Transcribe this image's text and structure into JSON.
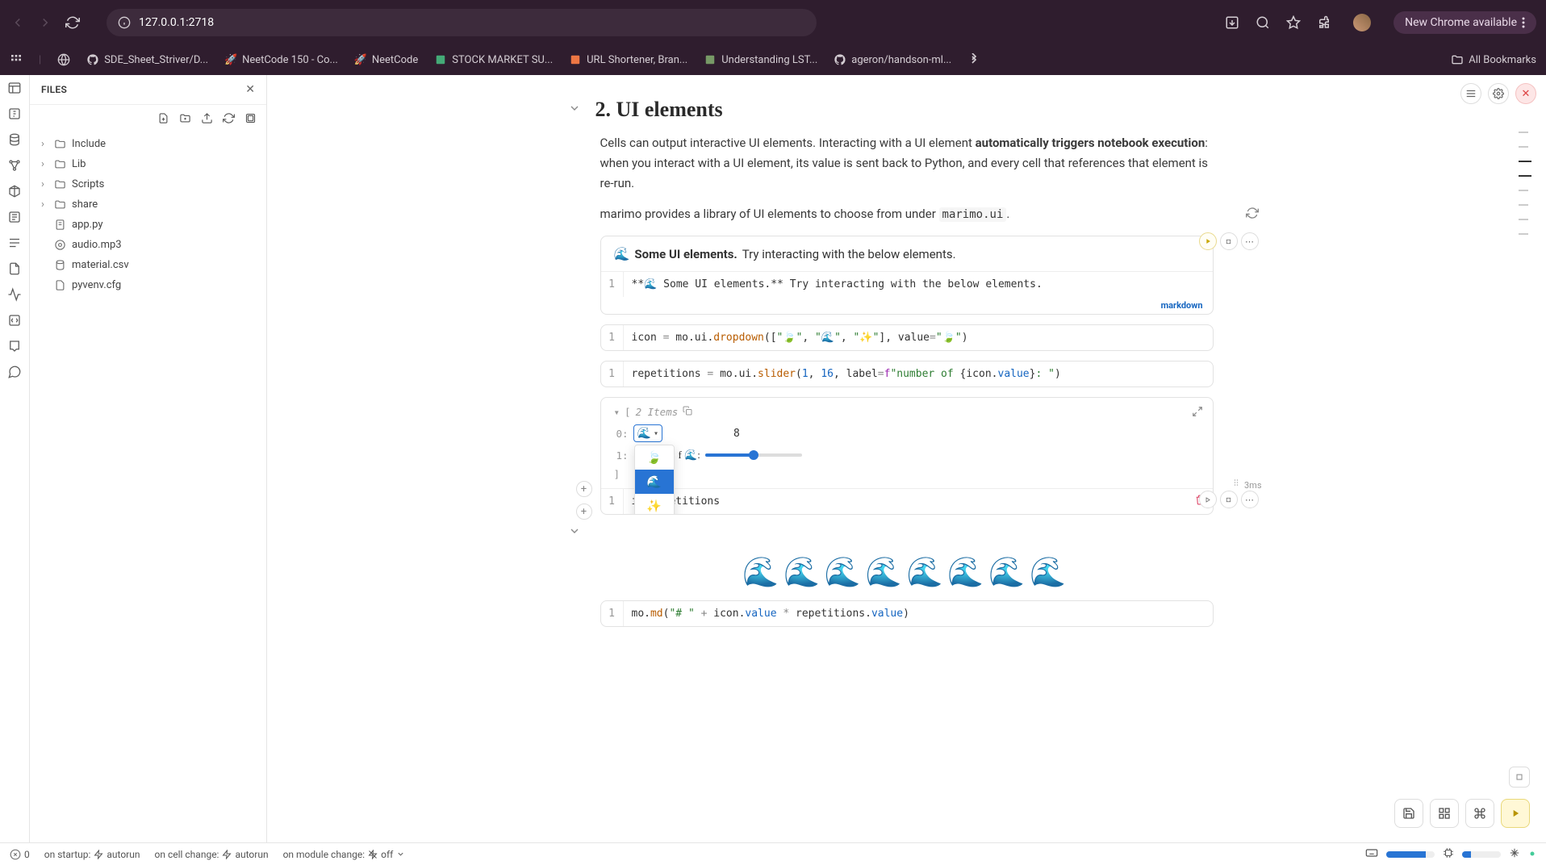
{
  "browser": {
    "url": "127.0.0.1:2718",
    "new_chrome": "New Chrome available",
    "bookmarks": [
      {
        "label": "SDE_Sheet_Striver/D...",
        "icon": "github"
      },
      {
        "label": "NeetCode 150 - Co...",
        "icon": "rocket"
      },
      {
        "label": "NeetCode",
        "icon": "rocket"
      },
      {
        "label": "STOCK MARKET SU...",
        "icon": "doc"
      },
      {
        "label": "URL Shortener, Bran...",
        "icon": "link"
      },
      {
        "label": "Understanding LST...",
        "icon": "img"
      },
      {
        "label": "ageron/handson-ml...",
        "icon": "github"
      }
    ],
    "all_bookmarks": "All Bookmarks"
  },
  "sidebar": {
    "title": "FILES",
    "folders": [
      {
        "name": "Include"
      },
      {
        "name": "Lib"
      },
      {
        "name": "Scripts"
      },
      {
        "name": "share"
      }
    ],
    "files": [
      {
        "name": "app.py",
        "icon": "py"
      },
      {
        "name": "audio.mp3",
        "icon": "audio"
      },
      {
        "name": "material.csv",
        "icon": "csv"
      },
      {
        "name": "pyvenv.cfg",
        "icon": "file"
      }
    ]
  },
  "section": {
    "title": "2. UI elements",
    "p1a": "Cells can output interactive UI elements. Interacting with a UI element ",
    "p1b": "automatically triggers notebook execution",
    "p1c": ": when you interact with a UI element, its value is sent back to Python, and every cell that references that element is re-run.",
    "p2a": "marimo provides a library of UI elements to choose from under ",
    "p2b": "marimo.ui",
    "p2c": "."
  },
  "cells": {
    "md_out_bold": "Some UI elements.",
    "md_out_rest": " Try interacting with the below elements.",
    "md_src": "**🌊 Some UI elements.** Try interacting with the below elements.",
    "md_lang": "markdown",
    "icon_src_pre": "icon = mo.ui.dropdown([\"",
    "icon_opt1": "🍃",
    "icon_sep1": "\", \"",
    "icon_opt2": "🌊",
    "icon_sep2": "\", \"",
    "icon_opt3": "✨",
    "icon_src_post": "\"], value=\"",
    "icon_val": "🍃",
    "icon_end": "\")",
    "rep_src": "repetitions = mo.ui.slider(1, 16, label=f\"number of {icon.value}: \")",
    "list_head": "2 Items",
    "slider_label": "f 🌊:",
    "slider_value": "8",
    "dropdown_sel": "🌊",
    "dropdown_opts": [
      "🍃",
      "🌊",
      "✨"
    ],
    "combine_src": "icon, repetitions",
    "combine_src_a": "ic",
    "combine_src_b": "etitions",
    "timing": "3ms",
    "waves": "🌊🌊🌊🌊🌊🌊🌊🌊",
    "final_src": "mo.md(\"# \" + icon.value * repetitions.value)"
  },
  "status": {
    "errors": "0",
    "startup": "on startup:",
    "startup_mode": "autorun",
    "cellchange": "on cell change:",
    "cellchange_mode": "autorun",
    "modchange": "on module change:",
    "modchange_mode": "off",
    "mem_pct": 82,
    "cpu_pct": 22
  }
}
